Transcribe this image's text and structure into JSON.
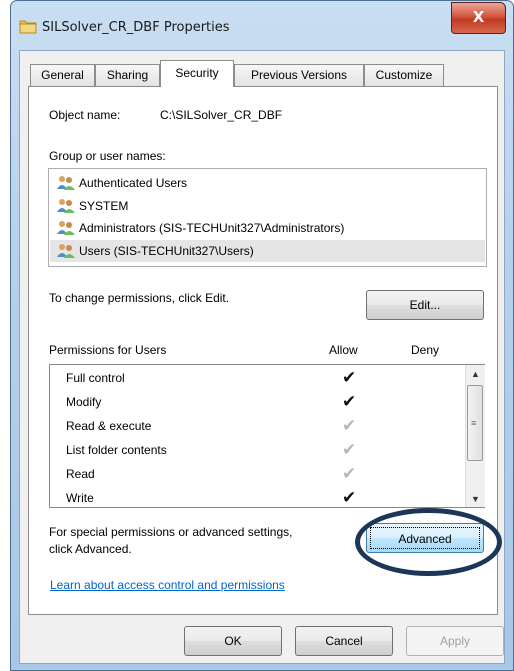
{
  "window": {
    "title": "SILSolver_CR_DBF Properties",
    "close_label": "X"
  },
  "tabs": [
    {
      "label": "General"
    },
    {
      "label": "Sharing"
    },
    {
      "label": "Security",
      "active": true
    },
    {
      "label": "Previous Versions"
    },
    {
      "label": "Customize"
    }
  ],
  "security": {
    "object_name_label": "Object name:",
    "object_name_value": "C:\\SILSolver_CR_DBF",
    "group_label": "Group or user names:",
    "groups": [
      {
        "name": "Authenticated Users",
        "icon": "users-group-icon"
      },
      {
        "name": "SYSTEM",
        "icon": "users-group-icon"
      },
      {
        "name": "Administrators (SIS-TECHUnit327\\Administrators)",
        "icon": "users-group-icon"
      },
      {
        "name": "Users (SIS-TECHUnit327\\Users)",
        "icon": "users-group-icon",
        "selected": true
      }
    ],
    "change_hint": "To change permissions, click Edit.",
    "edit_label": "Edit...",
    "permissions_label": "Permissions for Users",
    "allow_header": "Allow",
    "deny_header": "Deny",
    "permissions": [
      {
        "name": "Full control",
        "allow": "explicit",
        "deny": ""
      },
      {
        "name": "Modify",
        "allow": "explicit",
        "deny": ""
      },
      {
        "name": "Read & execute",
        "allow": "inherited",
        "deny": ""
      },
      {
        "name": "List folder contents",
        "allow": "inherited",
        "deny": ""
      },
      {
        "name": "Read",
        "allow": "inherited",
        "deny": ""
      },
      {
        "name": "Write",
        "allow": "explicit",
        "deny": ""
      }
    ],
    "special_hint_line1": "For special permissions or advanced settings,",
    "special_hint_line2": "click Advanced.",
    "advanced_label": "Advanced",
    "learn_link": "Learn about access control and permissions"
  },
  "footer": {
    "ok_label": "OK",
    "cancel_label": "Cancel",
    "apply_label": "Apply"
  },
  "check_glyph": "✔"
}
